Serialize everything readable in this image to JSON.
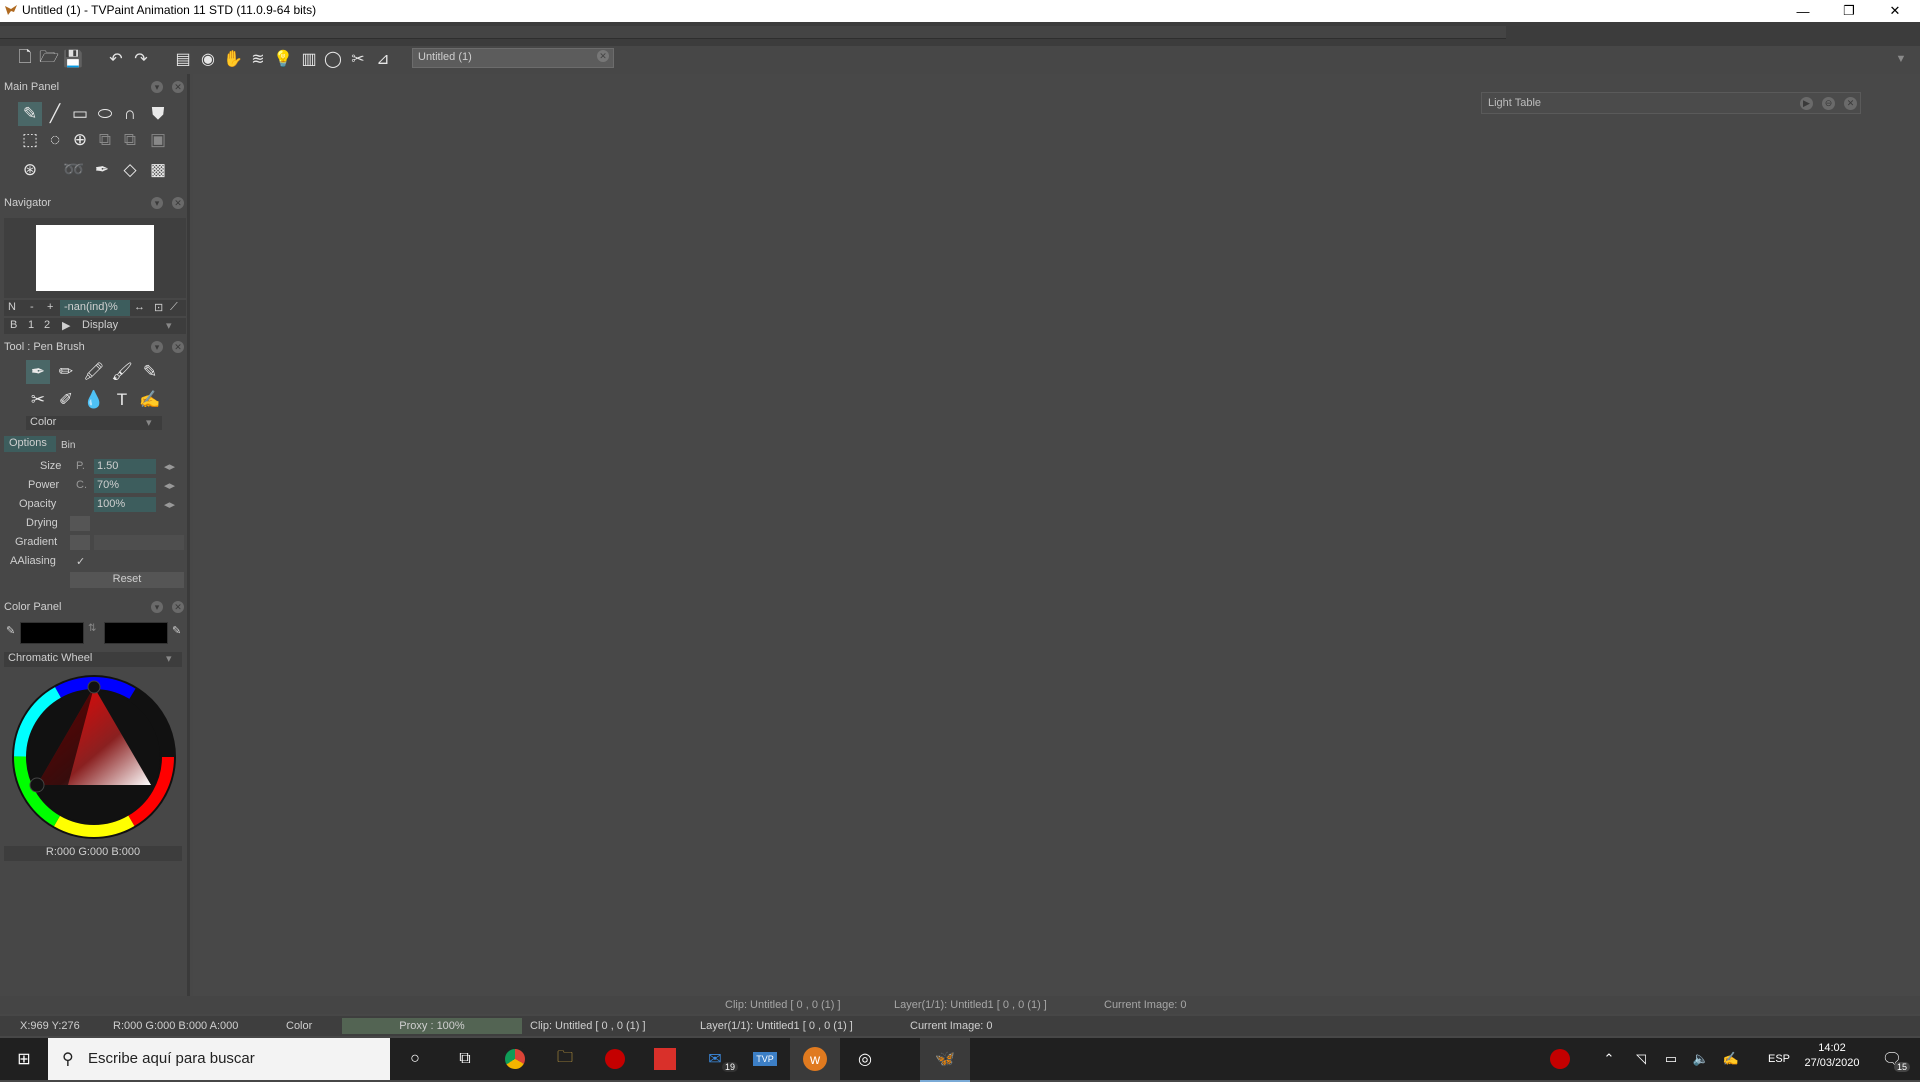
{
  "window": {
    "title": "Untitled (1) - TVPaint Animation 11 STD (11.0.9-64 bits)",
    "min_glyph": "—",
    "max_glyph": "❐",
    "close_glyph": "✕"
  },
  "toolbar": {
    "document_tab": "Untitled (1)"
  },
  "main_panel": {
    "title": "Main Panel"
  },
  "navigator": {
    "title": "Navigator",
    "btn_n": "N",
    "btn_minus": "-",
    "btn_plus": "+",
    "zoom_value": "-nan(ind)%",
    "btn_b": "B",
    "btn_1": "1",
    "btn_2": "2",
    "display_select": "Display"
  },
  "tool_panel": {
    "title": "Tool : Pen Brush",
    "mode_select": "Color",
    "tab_options": "Options",
    "tab_bin": "Bin",
    "rows": {
      "size_label": "Size",
      "size_prefix": "P.",
      "size_value": "1.50",
      "power_label": "Power",
      "power_prefix": "C.",
      "power_value": "70%",
      "opacity_label": "Opacity",
      "opacity_value": "100%",
      "drying_label": "Drying",
      "gradient_label": "Gradient",
      "aaliasing_label": "AAliasing",
      "aaliasing_check": "✓"
    },
    "reset_label": "Reset"
  },
  "color_panel": {
    "title": "Color Panel",
    "mode_select": "Chromatic Wheel",
    "readout": "R:000 G:000 B:000",
    "primary_color": "#000000",
    "secondary_color": "#000000"
  },
  "light_table": {
    "title": "Light Table"
  },
  "status_upper": {
    "clip": "Clip: Untitled [ 0 , 0  (1) ]",
    "layer": "Layer(1/1): Untitled1 [ 0 , 0  (1) ]",
    "current_image": "Current Image: 0"
  },
  "status_lower": {
    "coords": "X:969  Y:276",
    "rgba": "R:000 G:000 B:000 A:000",
    "color_label": "Color",
    "proxy": "Proxy : 100%",
    "clip": "Clip: Untitled [ 0 , 0  (1) ]",
    "layer": "Layer(1/1): Untitled1 [ 0 , 0  (1) ]",
    "current_image": "Current Image: 0"
  },
  "taskbar": {
    "search_placeholder": "Escribe aquí para buscar",
    "mail_badge": "19",
    "language": "ESP",
    "time": "14:02",
    "date": "27/03/2020",
    "notification_badge": "15"
  },
  "colors": {
    "background": "#474747",
    "accent": "#3d5d5d",
    "taskbar": "#202020"
  }
}
